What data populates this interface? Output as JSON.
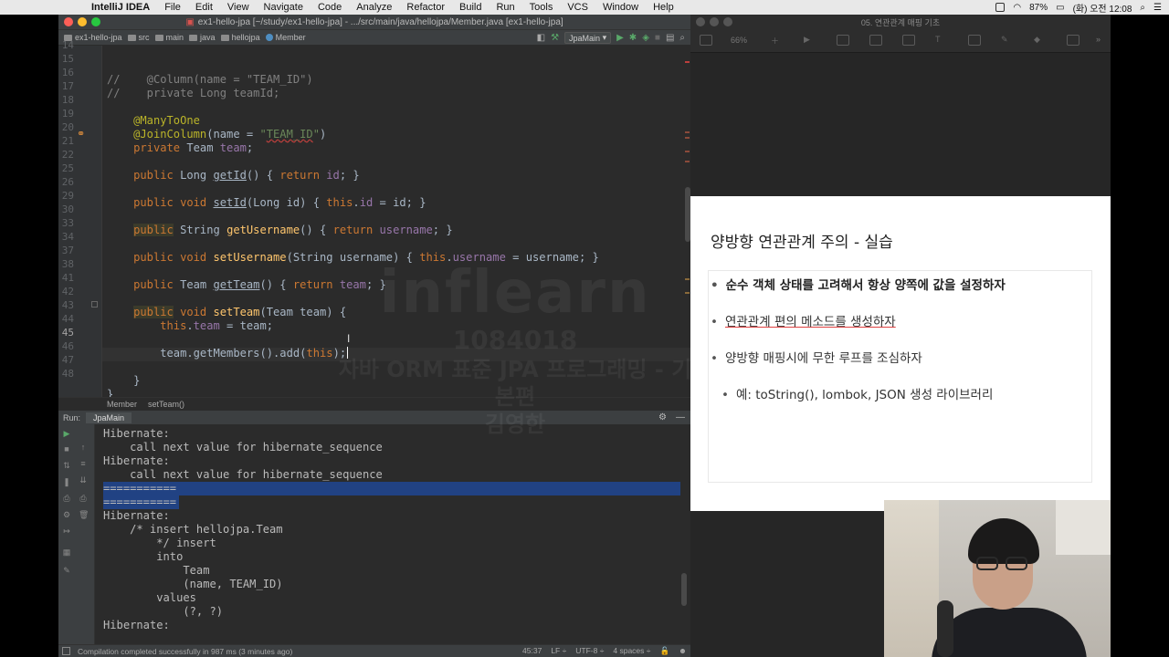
{
  "menubar": {
    "app_name": "IntelliJ IDEA",
    "menus": [
      "File",
      "Edit",
      "View",
      "Navigate",
      "Code",
      "Analyze",
      "Refactor",
      "Build",
      "Run",
      "Tools",
      "VCS",
      "Window",
      "Help"
    ],
    "battery": "87%",
    "clock": "(화) 오전 12:08"
  },
  "ide": {
    "window_title": "ex1-hello-jpa [~/study/ex1-hello-jpa] - .../src/main/java/hellojpa/Member.java [ex1-hello-jpa]",
    "breadcrumbs": [
      "ex1-hello-jpa",
      "src",
      "main",
      "java",
      "hellojpa",
      "Member"
    ],
    "run_config": "JpaMain",
    "editor_breadcrumb": [
      "Member",
      "setTeam()"
    ],
    "line_numbers": [
      "14",
      "15",
      "16",
      "17",
      "18",
      "19",
      "20",
      "21",
      "22",
      "25",
      "26",
      "29",
      "30",
      "33",
      "34",
      "37",
      "38",
      "41",
      "42",
      "43",
      "44",
      "45",
      "46",
      "47",
      "48"
    ],
    "run_panel": {
      "label": "Run:",
      "tab": "JpaMain",
      "console_lines": [
        "Hibernate:",
        "    call next value for hibernate_sequence",
        "Hibernate:",
        "    call next value for hibernate_sequence",
        "===========",
        "===========",
        "Hibernate:",
        "    /* insert hellojpa.Team",
        "        */ insert",
        "        into",
        "            Team",
        "            (name, TEAM_ID)",
        "        values",
        "            (?, ?)",
        "Hibernate:"
      ]
    },
    "status": {
      "message": "Compilation completed successfully in 987 ms (3 minutes ago)",
      "position": "45:37",
      "line_sep": "LF ÷",
      "encoding": "UTF-8 ÷",
      "indent": "4 spaces ÷"
    }
  },
  "watermark": {
    "logo": "inflearn",
    "id": "1084018",
    "course": "자바 ORM 표준 JPA 프로그래밍 - 기본편",
    "name": "김영한"
  },
  "keynote": {
    "window_title": "05. 연관관계 매핑 기초",
    "zoom": "66%",
    "slide": {
      "title": "양방향 연관관계 주의 - 실습",
      "bullets": [
        "순수 객체 상태를 고려해서 항상 양쪽에 값을 설정하자",
        "연관관계 편의 메소드를 생성하자",
        "양방향 매핑시에 무한 루프를 조심하자"
      ],
      "sub_bullet": "예: toString(), lombok, JSON 생성 라이브러리",
      "bullet_symbol": "•"
    }
  },
  "colors": {
    "editor_bg": "#2b2b2b",
    "keyword": "#cc7832",
    "annotation": "#bbb529",
    "string": "#6a8759",
    "field": "#9876aa",
    "method": "#ffc66d",
    "selection": "#214283"
  }
}
